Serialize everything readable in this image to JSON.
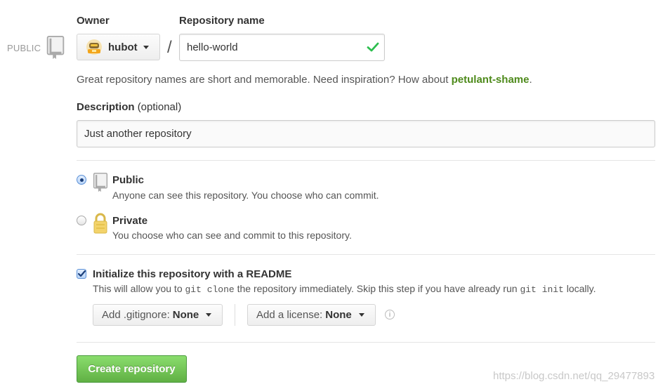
{
  "owner": {
    "label": "Owner",
    "selected": "hubot"
  },
  "public_tag": "PUBLIC",
  "repo_name": {
    "label": "Repository name",
    "value": "hello-world",
    "separator": "/"
  },
  "hint": {
    "text_before": "Great repository names are short and memorable. Need inspiration? How about ",
    "suggestion": "petulant-shame",
    "text_after": "."
  },
  "description": {
    "label": "Description",
    "optional": "(optional)",
    "value": "Just another repository"
  },
  "visibility": {
    "selected": "public",
    "public": {
      "title": "Public",
      "desc": "Anyone can see this repository. You choose who can commit."
    },
    "private": {
      "title": "Private",
      "desc": "You choose who can see and commit to this repository."
    }
  },
  "readme": {
    "checked": true,
    "label": "Initialize this repository with a README",
    "desc_1": "This will allow you to ",
    "code_1": "git clone",
    "desc_2": " the repository immediately. Skip this step if you have already run ",
    "code_2": "git init",
    "desc_3": " locally."
  },
  "gitignore": {
    "label": "Add .gitignore:",
    "value": "None"
  },
  "license": {
    "label": "Add a license:",
    "value": "None"
  },
  "info_glyph": "i",
  "create_button": "Create repository",
  "watermark": "https://blog.csdn.net/qq_29477893",
  "colors": {
    "accent_green": "#4e8a1b",
    "button_green": "#60b044",
    "check_green": "#2cbe4e"
  }
}
